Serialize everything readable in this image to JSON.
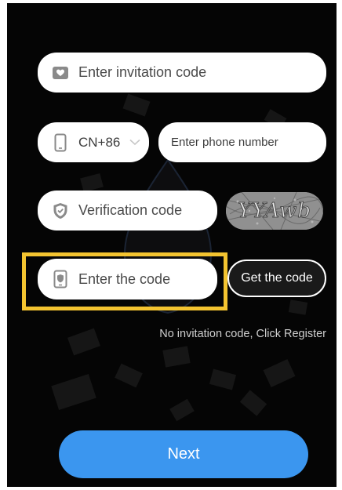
{
  "form": {
    "invitation_placeholder": "Enter invitation code",
    "country_code": "CN+86",
    "phone_placeholder": "Enter phone number",
    "verification_placeholder": "Verification code",
    "captcha_text": "YYAwb",
    "code_placeholder": "Enter the code",
    "get_code_label": "Get the code",
    "register_link": "No invitation code, Click Register",
    "next_label": "Next"
  },
  "icons": {
    "invitation": "mail-heart-icon",
    "phone": "phone-icon",
    "dropdown": "chevron-down-icon",
    "verification": "shield-check-icon",
    "code": "phone-shield-icon"
  },
  "colors": {
    "background": "#050505",
    "field": "#ffffff",
    "highlight": "#f4c430",
    "primary_button": "#3b96ef"
  }
}
